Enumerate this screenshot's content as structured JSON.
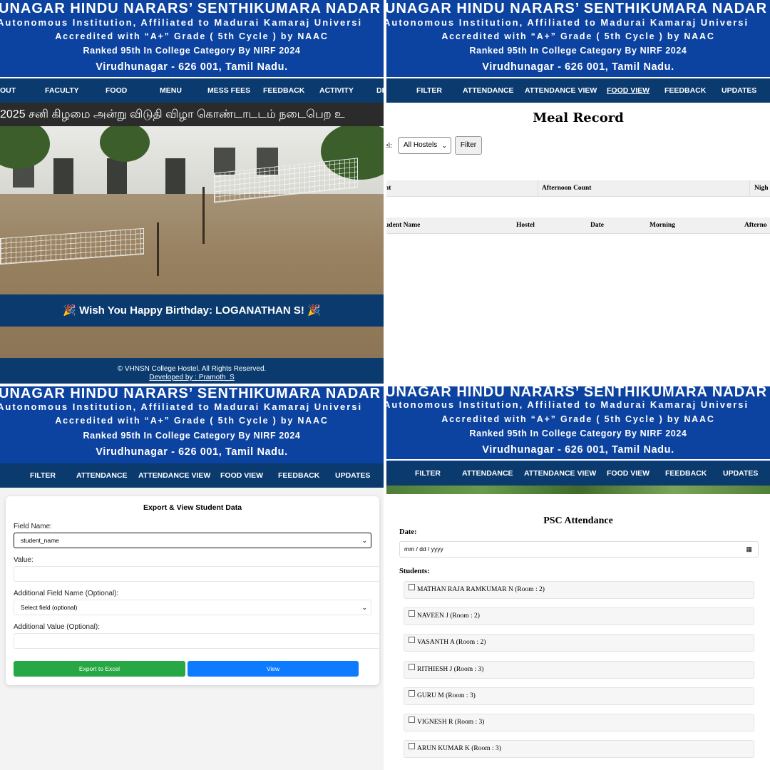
{
  "header": {
    "title": "UNAGAR HINDU NARARS’ SENTHIKUMARA NADAR C",
    "line1": "Autonomous Institution, Affiliated to Madurai Kamaraj Universi",
    "line2": "Accredited with “A+” Grade ( 5th Cycle ) by NAAC",
    "line3": "Ranked 95th In College Category By NIRF 2024",
    "place": "Virudhunagar - 626 001, Tamil Nadu."
  },
  "home_nav": [
    "OUT",
    "FACULTY",
    "FOOD",
    "MENU",
    "MESS FEES",
    "FEEDBACK",
    "ACTIVITY",
    "DI"
  ],
  "admin_nav": [
    "FILTER",
    "ATTENDANCE",
    "ATTENDANCE VIEW",
    "FOOD VIEW",
    "FEEDBACK",
    "UPDATES"
  ],
  "home": {
    "ticker": "2025 சனி கிழமை அன்று விடுதி விழா கொண்டாடடம் நடைபெற உ",
    "birthday": "🎉 Wish You Happy Birthday: LOGANATHAN S! 🎉",
    "footer_copy": "© VHNSN College Hostel. All Rights Reserved.",
    "footer_dev": "Developed by : Pramoth_S"
  },
  "meal": {
    "title": "Meal Record",
    "hostel_label": "el:",
    "hostel_value": "All Hostels",
    "filter_button": "Filter",
    "summary_columns": [
      "nt",
      "Afternoon Count",
      "Nigh"
    ],
    "detail_columns": [
      "udent Name",
      "Hostel",
      "Date",
      "Morning",
      "Afterno"
    ]
  },
  "export": {
    "title": "Export & View Student Data",
    "field_label": "Field Name:",
    "field_value": "student_name",
    "value_label": "Value:",
    "add_field_label": "Additional Field Name (Optional):",
    "add_field_value": "Select field (optional)",
    "add_value_label": "Additional Value (Optional):",
    "export_button": "Export to Excel",
    "view_button": "View"
  },
  "psc": {
    "title": "PSC Attendance",
    "date_label": "Date:",
    "date_placeholder": "mm / dd / yyyy",
    "students_label": "Students:",
    "students": [
      "MATHAN RAJA RAMKUMAR N (Room : 2)",
      "NAVEEN J (Room : 2)",
      "VASANTH A (Room : 2)",
      "RITHIESH J (Room : 3)",
      "GURU M (Room : 3)",
      "VIGNESH R (Room : 3)",
      "ARUN KUMAR K (Room : 3)"
    ]
  },
  "colors": {
    "header_blue": "#0c42a0",
    "nav_navy": "#0a3a6e",
    "green": "#27a844",
    "blue": "#0d7bff"
  }
}
